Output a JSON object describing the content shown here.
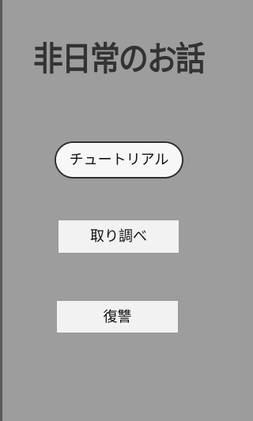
{
  "game": {
    "title": "非日常のお話",
    "menu": {
      "tutorial_label": "チュートリアル",
      "interrogation_label": "取り調べ",
      "revenge_label": "復讐"
    }
  },
  "colors": {
    "background": "#9d9d9d",
    "button": "#f2f2f2",
    "title_text": "#333333"
  }
}
